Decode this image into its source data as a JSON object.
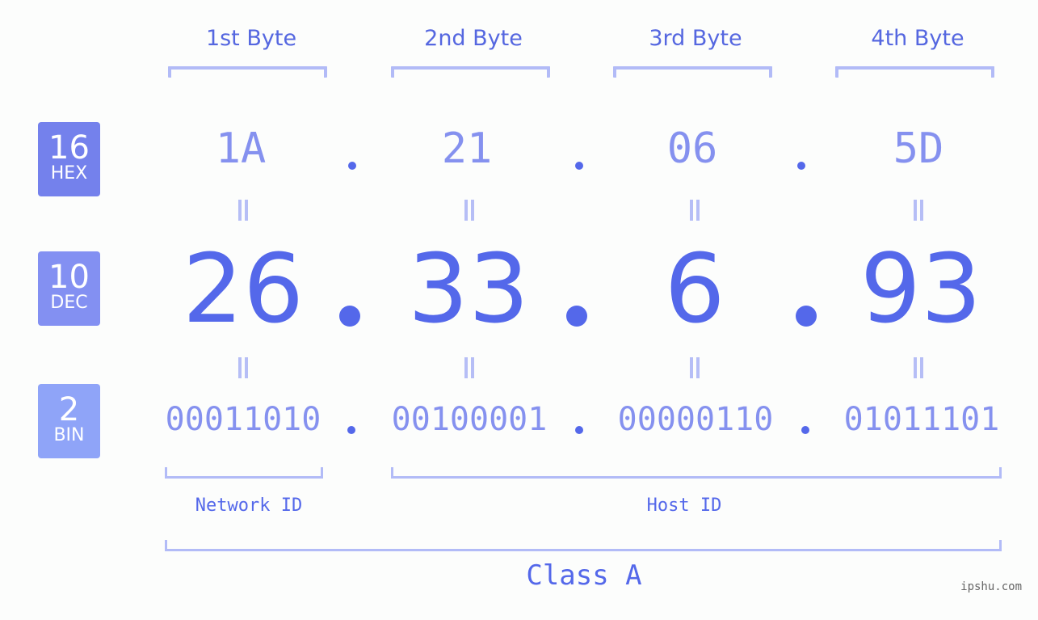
{
  "bytes": [
    {
      "label": "1st Byte",
      "hex": "1A",
      "dec": "26",
      "bin": "00011010"
    },
    {
      "label": "2nd Byte",
      "hex": "21",
      "dec": "33",
      "bin": "00100001"
    },
    {
      "label": "3rd Byte",
      "hex": "06",
      "dec": "6",
      "bin": "00000110"
    },
    {
      "label": "4th Byte",
      "hex": "5D",
      "dec": "93",
      "bin": "01011101"
    }
  ],
  "badges": {
    "hex": {
      "base": "16",
      "label": "HEX",
      "color": "#7481ec"
    },
    "dec": {
      "base": "10",
      "label": "DEC",
      "color": "#8390f2"
    },
    "bin": {
      "base": "2",
      "label": "BIN",
      "color": "#8fa4f8"
    }
  },
  "network_id_label": "Network ID",
  "host_id_label": "Host ID",
  "class_label": "Class A",
  "watermark": "ipshu.com",
  "colors": {
    "accent": "#5468ea",
    "light": "#8591ef",
    "bracket": "#b2bbf7"
  }
}
